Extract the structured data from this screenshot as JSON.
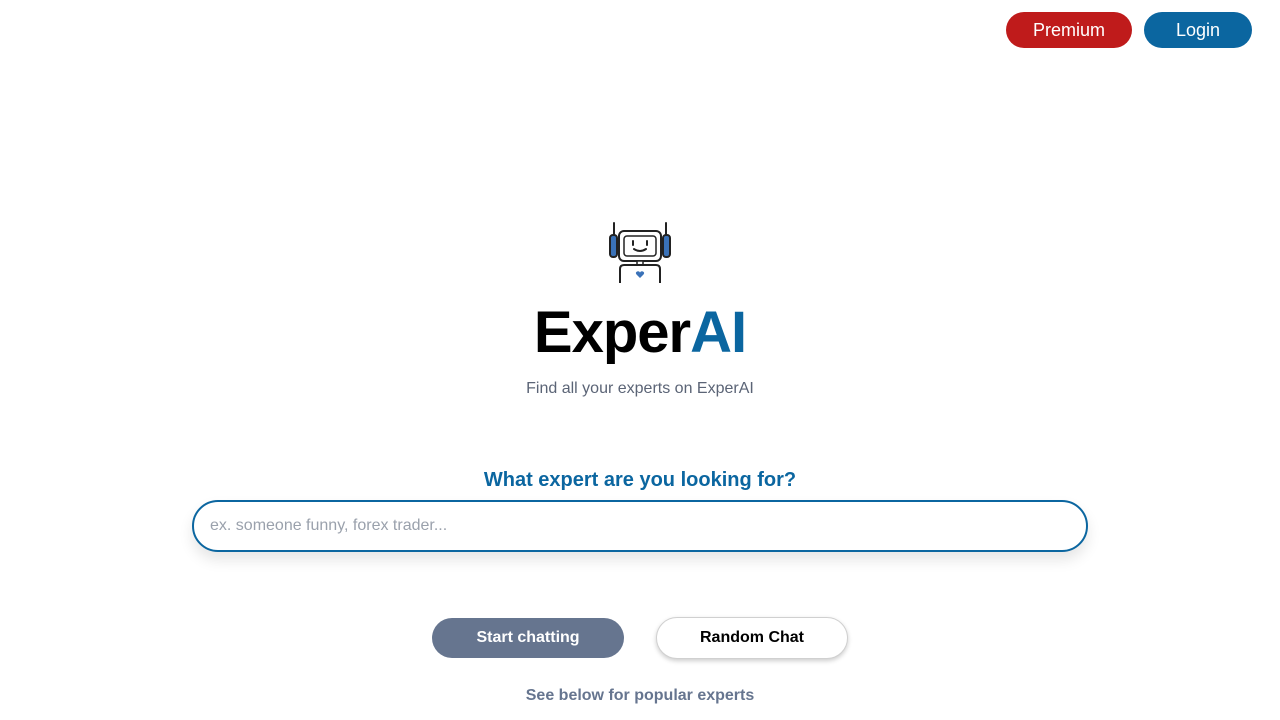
{
  "header": {
    "premium_label": "Premium",
    "login_label": "Login"
  },
  "hero": {
    "logo_icon": "robot-icon",
    "brand_part1": "Exper",
    "brand_part2": "AI",
    "tagline": "Find all your experts on ExperAI"
  },
  "search": {
    "prompt": "What expert are you looking for?",
    "value": "",
    "placeholder": "ex. someone funny, forex trader..."
  },
  "actions": {
    "start_label": "Start chatting",
    "random_label": "Random Chat"
  },
  "footer": {
    "note": "See below for popular experts"
  },
  "colors": {
    "accent": "#0b66a0",
    "premium": "#bf1b1b",
    "start_button": "#66758f",
    "muted_text": "#5b6476"
  }
}
